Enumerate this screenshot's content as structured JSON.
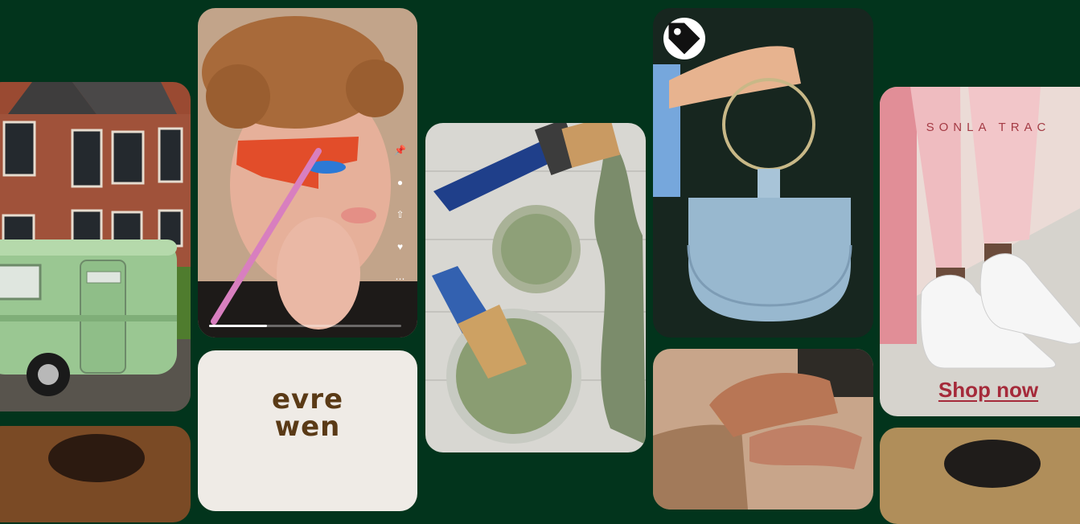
{
  "pins": {
    "evrewen": {
      "logo_line1": "evre",
      "logo_line2": "wen"
    },
    "makeup": {
      "progress": 0.3,
      "actions": [
        "pin-icon",
        "comment-icon",
        "share-icon",
        "heart-icon",
        "more-icon"
      ]
    },
    "bag": {
      "badge_icon": "tag-icon"
    },
    "sneakers": {
      "brand": "SONLA TRAC",
      "cta": "Shop now"
    }
  },
  "colors": {
    "background": "#02341c",
    "cta": "#a52a3a",
    "logo": "#5a3a16"
  }
}
